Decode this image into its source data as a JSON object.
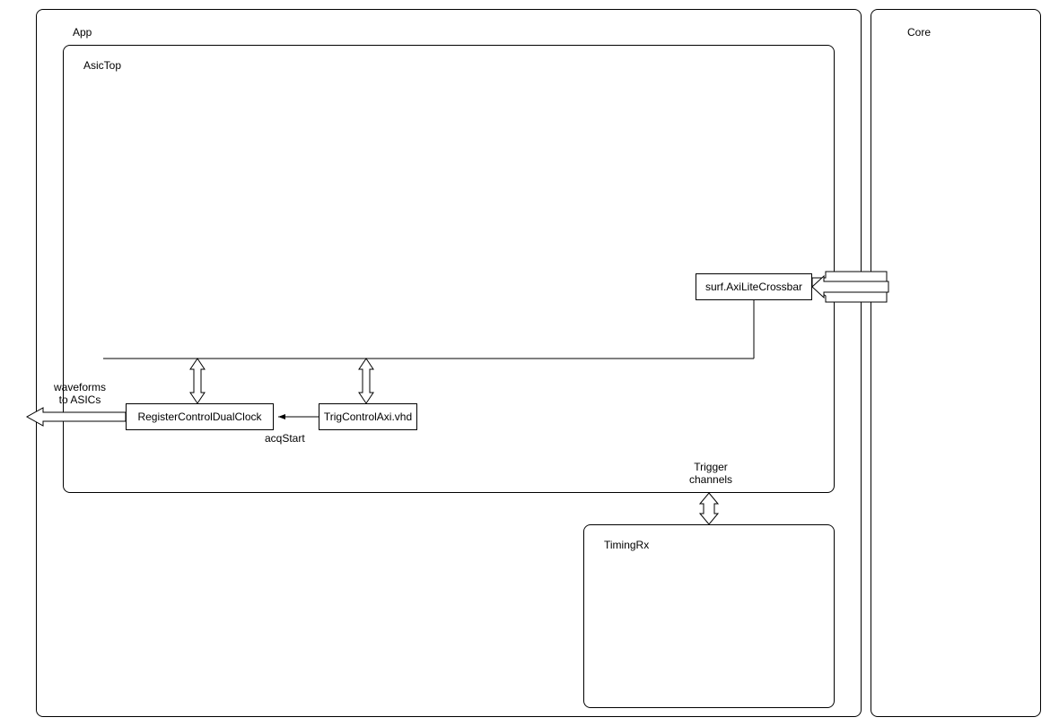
{
  "diagram": {
    "containers": {
      "app": "App",
      "core": "Core",
      "asictop": "AsicTop",
      "timingrx": "TimingRx"
    },
    "blocks": {
      "axilite": "surf.AxiLiteCrossbar",
      "regctrl": "RegisterControlDualClock",
      "trigctrl": "TrigControlAxi.vhd"
    },
    "labels": {
      "waveforms": "waveforms\nto ASICs",
      "acqstart": "acqStart",
      "trigger": "Trigger\nchannels"
    }
  }
}
